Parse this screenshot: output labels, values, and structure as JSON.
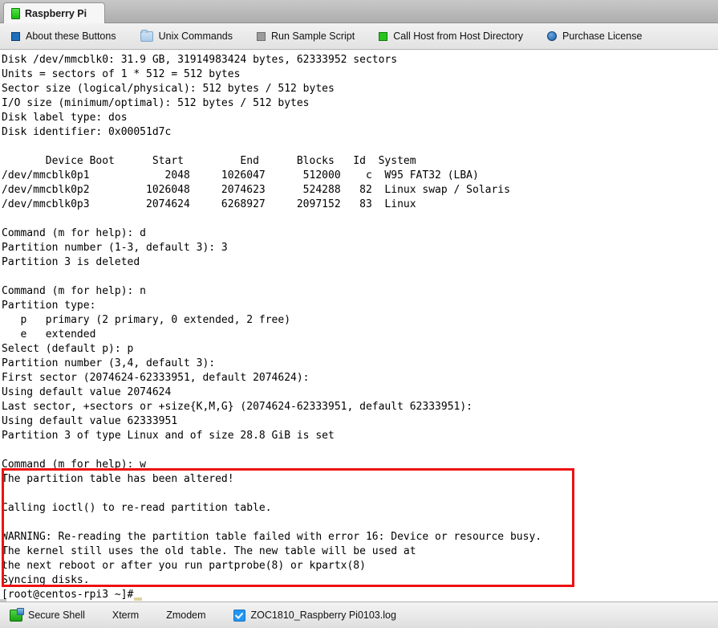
{
  "window": {
    "tab": {
      "label": "Raspberry Pi",
      "icon": "green-square-icon"
    }
  },
  "toolbar": {
    "buttons": [
      {
        "label": "About these Buttons",
        "icon": "blue-square-icon"
      },
      {
        "label": "Unix Commands",
        "icon": "folder-icon"
      },
      {
        "label": "Run Sample Script",
        "icon": "gray-square-icon"
      },
      {
        "label": "Call Host from Host Directory",
        "icon": "green-square-icon"
      },
      {
        "label": "Purchase License",
        "icon": "blue-circle-icon"
      }
    ]
  },
  "terminal": {
    "content": "Disk /dev/mmcblk0: 31.9 GB, 31914983424 bytes, 62333952 sectors\nUnits = sectors of 1 * 512 = 512 bytes\nSector size (logical/physical): 512 bytes / 512 bytes\nI/O size (minimum/optimal): 512 bytes / 512 bytes\nDisk label type: dos\nDisk identifier: 0x00051d7c\n\n       Device Boot      Start         End      Blocks   Id  System\n/dev/mmcblk0p1            2048     1026047      512000    c  W95 FAT32 (LBA)\n/dev/mmcblk0p2         1026048     2074623      524288   82  Linux swap / Solaris\n/dev/mmcblk0p3         2074624     6268927     2097152   83  Linux\n\nCommand (m for help): d\nPartition number (1-3, default 3): 3\nPartition 3 is deleted\n\nCommand (m for help): n\nPartition type:\n   p   primary (2 primary, 0 extended, 2 free)\n   e   extended\nSelect (default p): p\nPartition number (3,4, default 3):\nFirst sector (2074624-62333951, default 2074624):\nUsing default value 2074624\nLast sector, +sectors or +size{K,M,G} (2074624-62333951, default 62333951):\nUsing default value 62333951\nPartition 3 of type Linux and of size 28.8 GiB is set\n\nCommand (m for help): w\nThe partition table has been altered!\n\nCalling ioctl() to re-read partition table.\n\nWARNING: Re-reading the partition table failed with error 16: Device or resource busy.\nThe kernel still uses the old table. The new table will be used at\nthe next reboot or after you run partprobe(8) or kpartx(8)\nSyncing disks.\n[root@centos-rpi3 ~]# ",
    "prompt": "[root@centos-rpi3 ~]#"
  },
  "annotation": {
    "color": "#ee1111",
    "highlighted_text": "The partition table has been altered!  Calling ioctl() to re-read partition table.  WARNING: Re-reading the partition table failed with error 16: Device or resource busy. The kernel still uses the old table. The new table will be used at the next reboot or after you run partprobe(8) or kpartx(8) Syncing disks."
  },
  "statusbar": {
    "items": [
      {
        "label": "Secure Shell",
        "icon": "secure-shell-icon"
      },
      {
        "label": "Xterm",
        "icon": "none"
      },
      {
        "label": "Zmodem",
        "icon": "none"
      },
      {
        "label": "ZOC1810_Raspberry Pi0103.log",
        "icon": "checkbox-checked-icon"
      }
    ]
  }
}
